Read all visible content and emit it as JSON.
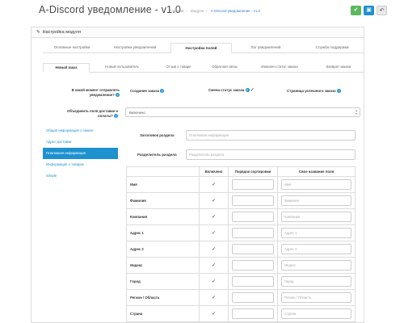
{
  "header": {
    "title": "A-Discord уведомление - v1.0",
    "breadcrumb": [
      "Главная",
      "Модули",
      "A-Discord уведомление - v1.0"
    ]
  },
  "panel": {
    "heading": "Настройка модуля"
  },
  "tabs_main": [
    "Основные настройки",
    "Настройка уведомлений",
    "Настройка полей",
    "Лог уведомлений",
    "Служба поддержки"
  ],
  "tabs_sub": [
    "Новый заказ",
    "Новый пользователь",
    "Отзыв о товаре",
    "Обратная связь",
    "Изменен статус заказа",
    "Возврат заказа"
  ],
  "question": {
    "label": "В какой момент отправлять уведомление?",
    "options": [
      "Создание заказа",
      "Смена статус заказа",
      "Страница успешного заказа"
    ]
  },
  "merge": {
    "label": "Объединить поля доставки и оплаты?",
    "value": "Включено"
  },
  "sidenav": [
    "Общая информация о заказе",
    "Адрес доставки",
    "Платежная информация",
    "Информация о товарах",
    "Simple"
  ],
  "section_header": {
    "label": "Заголовок раздела",
    "placeholder": "Платежная информация"
  },
  "section_divider": {
    "label": "Разделитель раздела",
    "placeholder": "Разделитель раздела"
  },
  "table": {
    "headers": [
      "",
      "Включено",
      "Порядок сортировки",
      "Свое название поля"
    ],
    "rows": [
      {
        "name": "Имя",
        "placeholder": "Имя"
      },
      {
        "name": "Фамилия",
        "placeholder": "Фамилия"
      },
      {
        "name": "Компания",
        "placeholder": "Компания"
      },
      {
        "name": "Адрес 1",
        "placeholder": "Адрес 1"
      },
      {
        "name": "Адрес 2",
        "placeholder": "Адрес 2"
      },
      {
        "name": "Индекс",
        "placeholder": "Индекс"
      },
      {
        "name": "Город",
        "placeholder": "Город"
      },
      {
        "name": "Регион / Область",
        "placeholder": "Регион / Область"
      },
      {
        "name": "Страна",
        "placeholder": "Страна"
      }
    ]
  },
  "colors": {
    "accent": "#1e91cf",
    "save": "#5cb85c"
  },
  "icons": [
    "save-icon",
    "floppy-icon",
    "back-icon",
    "pencil-icon",
    "help-icon",
    "check-icon"
  ]
}
